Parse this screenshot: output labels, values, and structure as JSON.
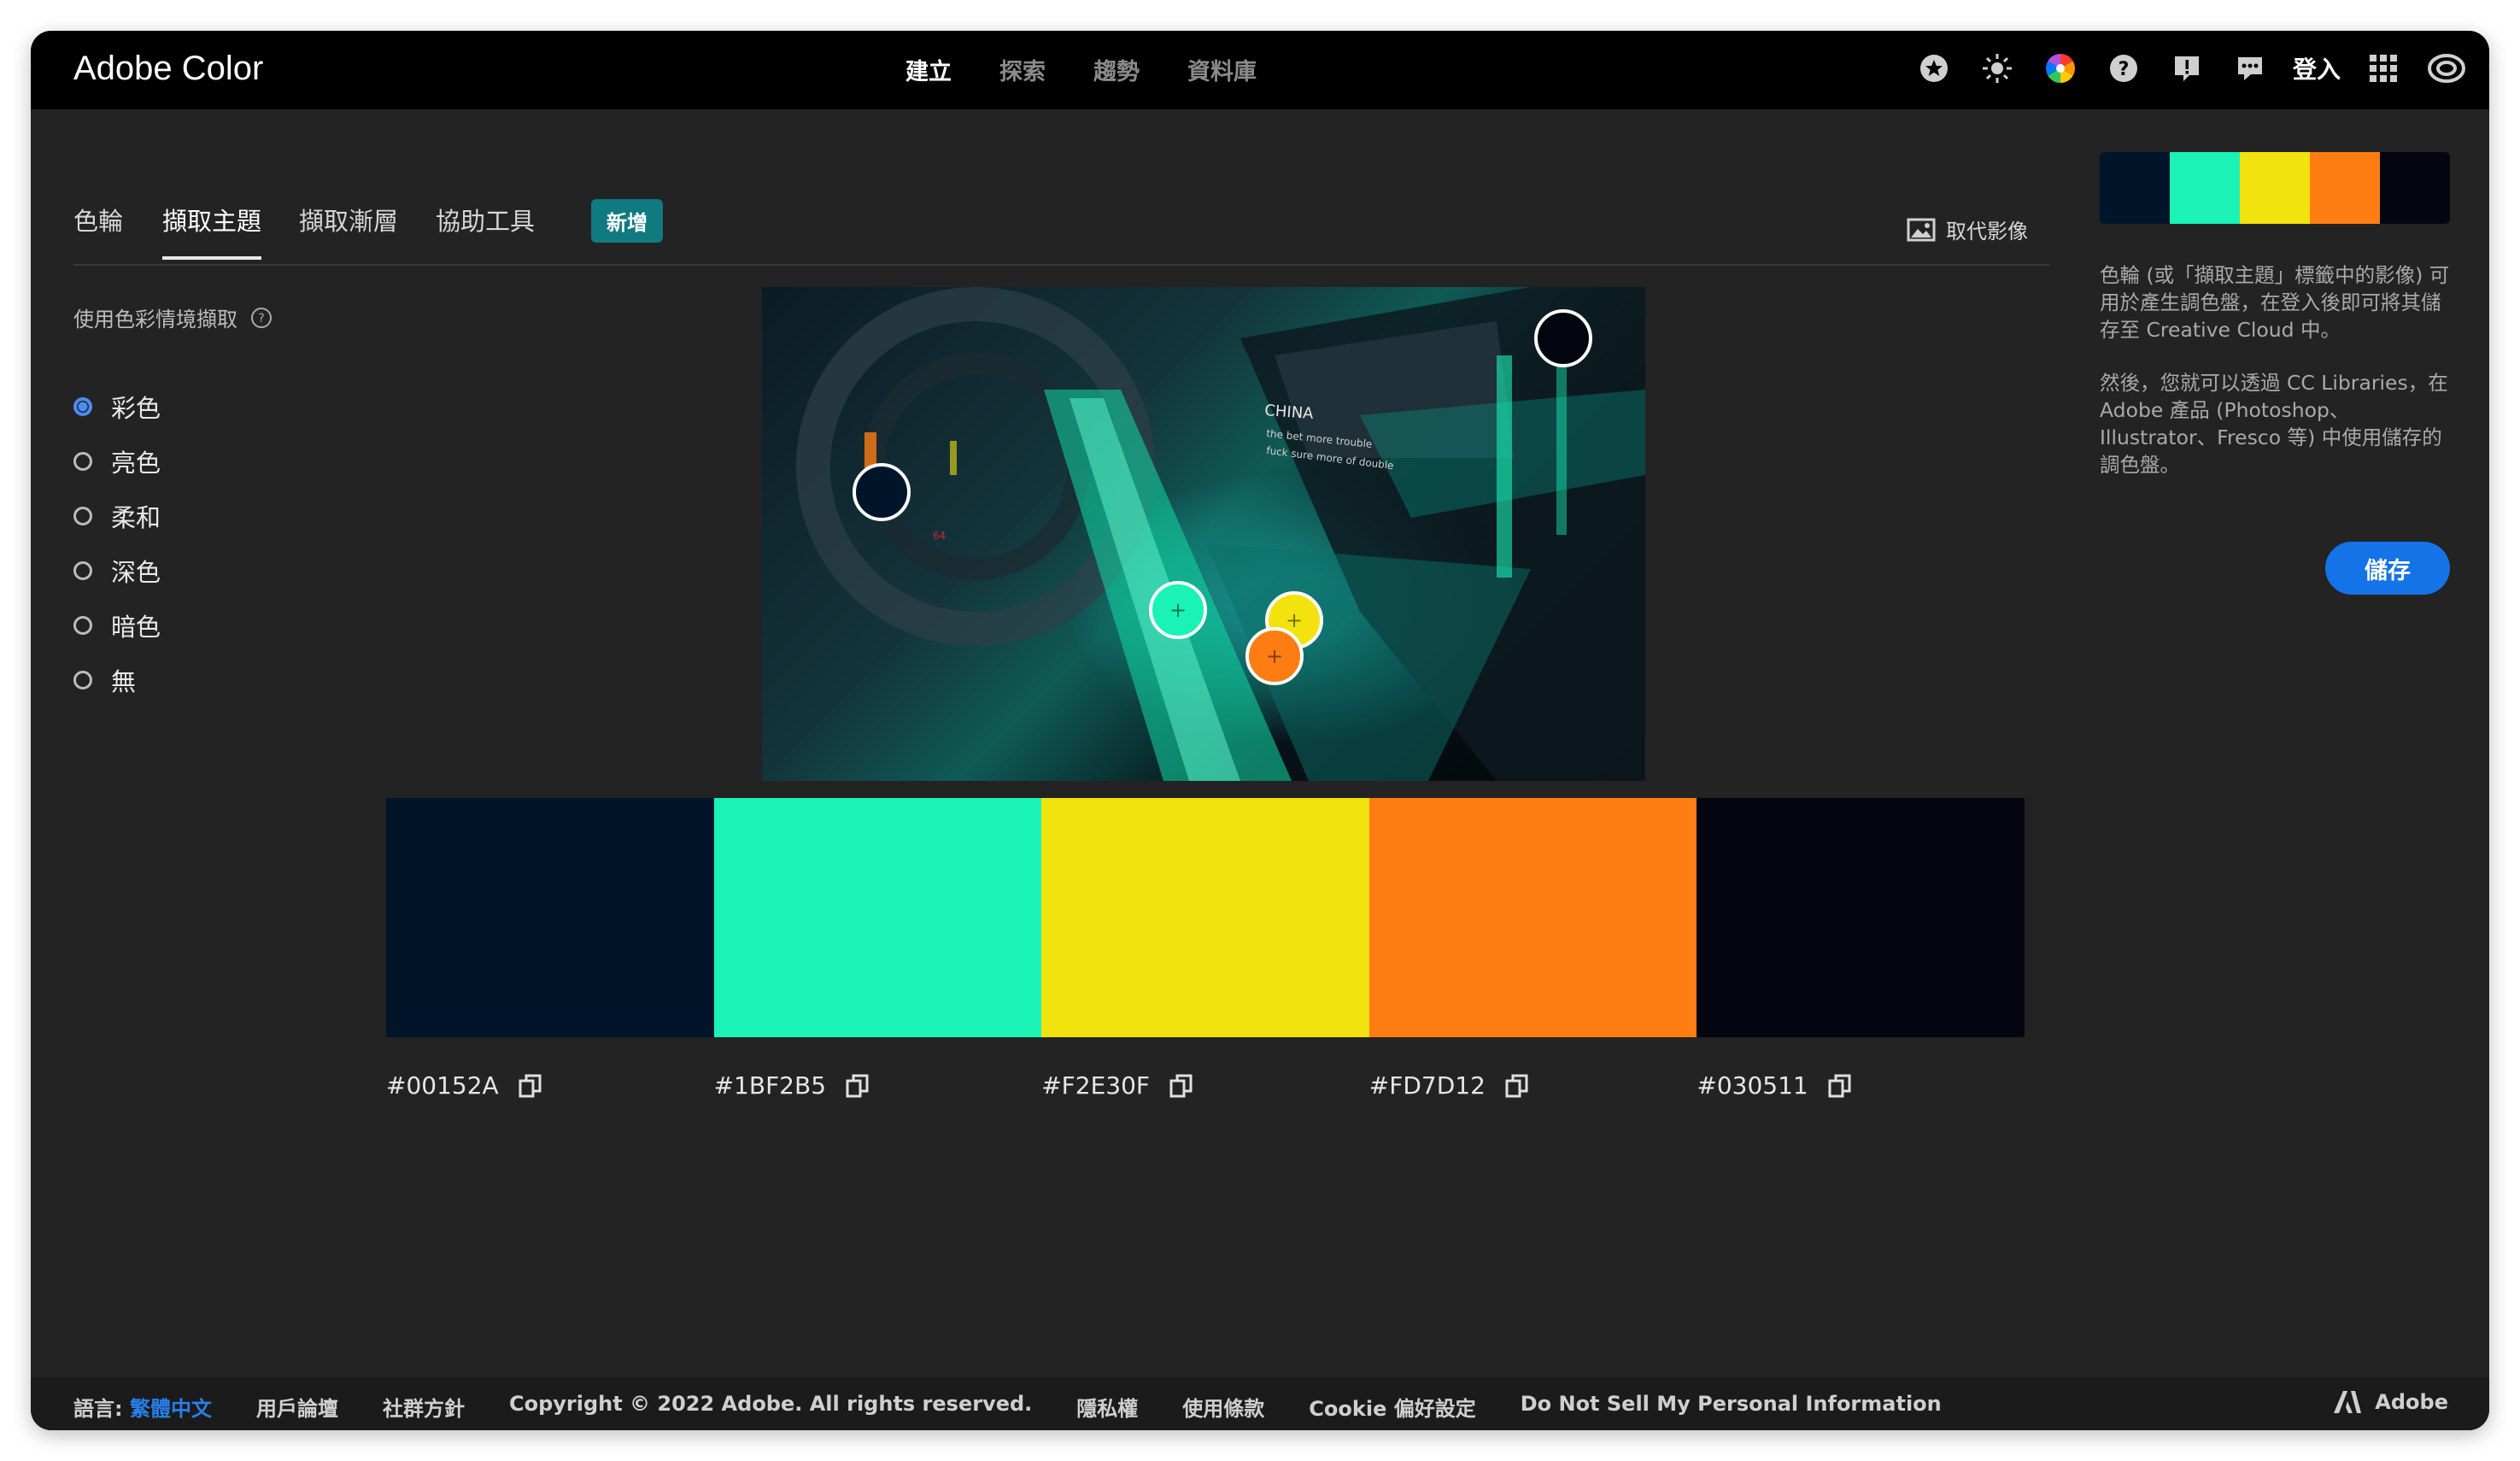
{
  "app": {
    "title": "Adobe Color"
  },
  "topnav": [
    "建立",
    "探索",
    "趨勢",
    "資料庫"
  ],
  "header": {
    "signin": "登入"
  },
  "tabs": {
    "items": [
      "色輪",
      "擷取主題",
      "擷取漸層",
      "協助工具"
    ],
    "badge": "新增",
    "replace_image": "取代影像"
  },
  "mood": {
    "title": "使用色彩情境擷取",
    "options": [
      "彩色",
      "亮色",
      "柔和",
      "深色",
      "暗色",
      "無"
    ],
    "selected": "彩色"
  },
  "palette": {
    "colors": [
      "#00152A",
      "#1BF2B5",
      "#F2E30F",
      "#FD7D12",
      "#030511"
    ]
  },
  "info": {
    "p1": "色輪 (或「擷取主題」標籤中的影像) 可用於產生調色盤，在登入後即可將其儲存至 Creative Cloud 中。",
    "p2": "然後，您就可以透過 CC Libraries，在 Adobe 產品 (Photoshop、Illustrator、Fresco 等) 中使用儲存的調色盤。",
    "save": "儲存"
  },
  "image_text": {
    "sign_main": "CHINA",
    "sign_line1": "the bet more trouble",
    "sign_line2": "fuck sure more of double",
    "tag": "64"
  },
  "footer": {
    "lang_label": "語言:",
    "lang_value": "繁體中文",
    "links": [
      "用戶論壇",
      "社群方針",
      "Copyright © 2022 Adobe. All rights reserved.",
      "隱私權",
      "使用條款",
      "Cookie 偏好設定",
      "Do Not Sell My Personal Information"
    ],
    "brand": "Adobe"
  }
}
